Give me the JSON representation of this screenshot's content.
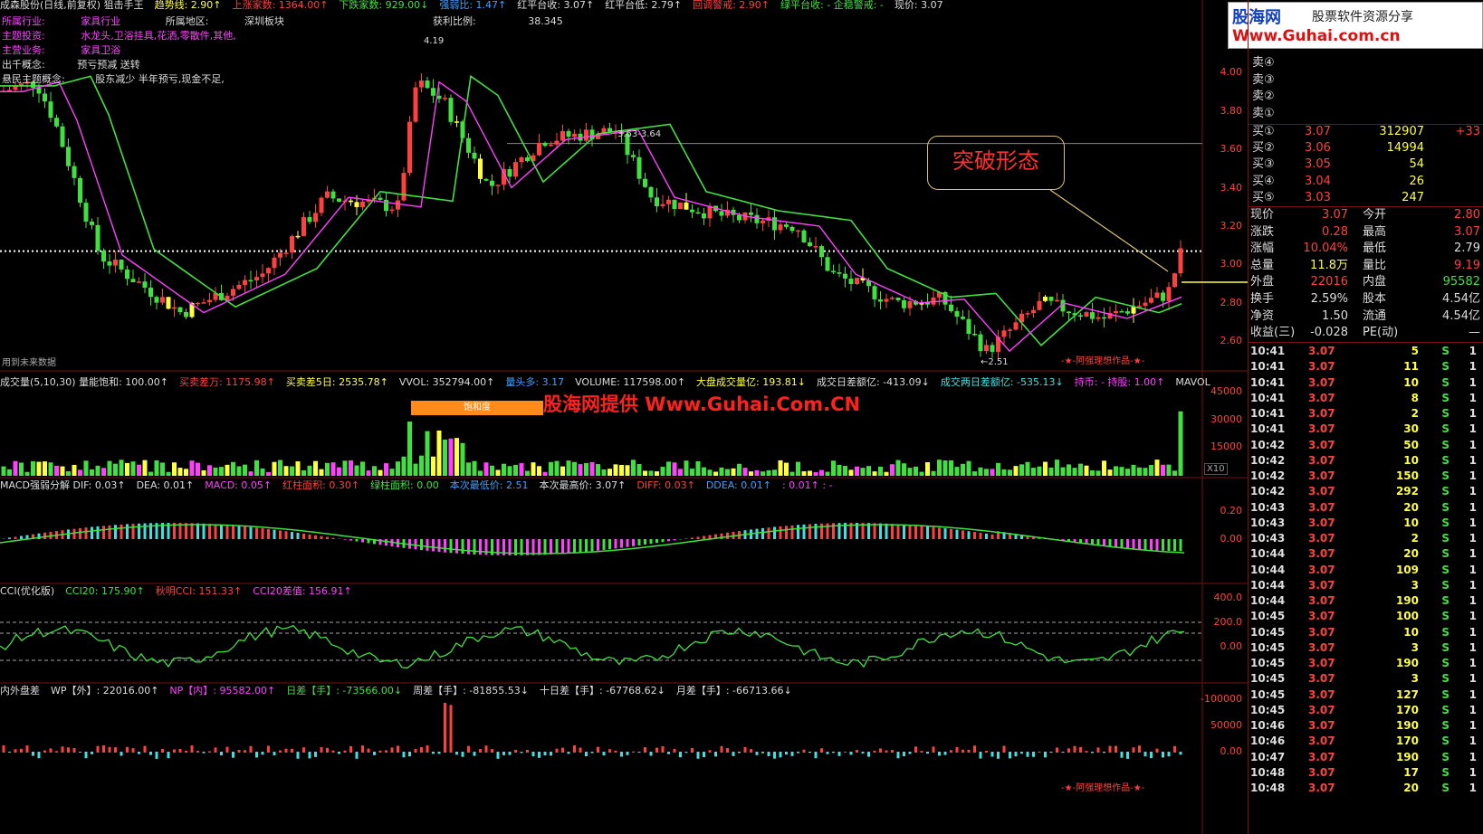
{
  "colors": {
    "up": "#ff4040",
    "down": "#40e040",
    "yellow": "#ffff40",
    "magenta": "#ff40ff",
    "cyan": "#40e0e0",
    "grid": "#7a1010"
  },
  "header": {
    "items": [
      {
        "text": "成森股份(日线,前复权) 狙击手王",
        "color": "#dddddd"
      },
      {
        "text": "趋势线: 2.90↑",
        "color": "#ffff40"
      },
      {
        "text": "上涨家数: 1364.00↑",
        "color": "#ff4040"
      },
      {
        "text": "下跌家数: 929.00↓",
        "color": "#40e040"
      },
      {
        "text": "强弱比: 1.47↑",
        "color": "#40a0ff"
      },
      {
        "text": "红平台收: 3.07↑",
        "color": "#dddddd"
      },
      {
        "text": "红平台低: 2.79↑",
        "color": "#dddddd"
      },
      {
        "text": "回调警戒: 2.90↑",
        "color": "#ff4040"
      },
      {
        "text": "绿平台收: - 企稳警戒: -",
        "color": "#40e040"
      },
      {
        "text": "现价: 3.07",
        "color": "#dddddd"
      }
    ]
  },
  "info_lines": [
    {
      "label": "所属行业:",
      "value": "家具行业",
      "extra_label": "所属地区:",
      "extra_value": "深圳板块",
      "color": "#ff40ff"
    },
    {
      "label": "主题投资:",
      "value": "水龙头,卫浴挂具,花洒,零散件,其他,",
      "color": "#ff40ff"
    },
    {
      "label": "主营业务:",
      "value": "家具卫浴",
      "color": "#ff40ff"
    },
    {
      "label": "出千概念:",
      "value": "预亏预减 送转",
      "color": "#dddddd"
    },
    {
      "label": "悬民主题概念:",
      "value": "股东减少 半年预亏,现金不足,",
      "color": "#dddddd"
    }
  ],
  "profit_ratio": {
    "label": "获利比例:",
    "value": "38.345"
  },
  "price_axis": [
    "4.00",
    "3.80",
    "3.60",
    "3.40",
    "3.20",
    "3.00",
    "2.80",
    "2.60"
  ],
  "annotations": {
    "high": "4.19",
    "low": "←2.51",
    "platform": "3.63-3.64",
    "future_note": "用到未来数据",
    "author": "-★-阿强理想作品-★-"
  },
  "callout_text": "突破形态",
  "watermark": "股海网提供 Www.Guhai.Com.CN",
  "volume_header": [
    {
      "text": "成交量(5,10,30) 量能饱和: 100.00↑",
      "color": "#dddddd"
    },
    {
      "text": "买卖差万: 1175.98↑",
      "color": "#ff4040"
    },
    {
      "text": "买卖差5日: 2535.78↑",
      "color": "#ffff40"
    },
    {
      "text": "VVOL: 352794.00↑",
      "color": "#dddddd"
    },
    {
      "text": "量头多: 3.17",
      "color": "#40a0ff"
    },
    {
      "text": "VOLUME: 117598.00↑",
      "color": "#dddddd"
    },
    {
      "text": "大盘成交量亿: 193.81↓",
      "color": "#ffff40"
    },
    {
      "text": "成交日差额亿: -413.09↓",
      "color": "#dddddd"
    },
    {
      "text": "成交两日差额亿: -535.13↓",
      "color": "#40e0e0"
    },
    {
      "text": "持币: - 持股: 1.00↑",
      "color": "#ff40ff"
    },
    {
      "text": "MAVOL",
      "color": "#dddddd"
    }
  ],
  "saturation_label": "饱和度",
  "volume_axis": [
    "45000",
    "30000",
    "15000"
  ],
  "volume_unit": "X10",
  "macd_header": [
    {
      "text": "MACD强弱分解 DIF: 0.03↑",
      "color": "#dddddd"
    },
    {
      "text": "DEA: 0.01↑",
      "color": "#dddddd"
    },
    {
      "text": "MACD: 0.05↑",
      "color": "#ff40ff"
    },
    {
      "text": "红柱面积: 0.30↑",
      "color": "#ff4040"
    },
    {
      "text": "绿柱面积: 0.00",
      "color": "#40e040"
    },
    {
      "text": "本次最低价: 2.51",
      "color": "#40a0ff"
    },
    {
      "text": "本次最高价: 3.07↑",
      "color": "#dddddd"
    },
    {
      "text": "DIFF: 0.03↑",
      "color": "#ff4040"
    },
    {
      "text": "DDEA: 0.01↑",
      "color": "#40a0ff"
    },
    {
      "text": ": 0.01↑ : -",
      "color": "#ff40ff"
    }
  ],
  "macd_axis": [
    "0.20",
    "0.00"
  ],
  "cci_header": [
    {
      "text": "CCI(优化版)",
      "color": "#dddddd"
    },
    {
      "text": "CCI20: 175.90↑",
      "color": "#40e040"
    },
    {
      "text": "秋明CCI: 151.33↑",
      "color": "#ff4040"
    },
    {
      "text": "CCI20差值: 156.91↑",
      "color": "#ff40ff"
    }
  ],
  "cci_axis": [
    "400.0",
    "200.0",
    "0.00"
  ],
  "np_header": [
    {
      "text": "内外盘差",
      "color": "#dddddd"
    },
    {
      "text": "WP【外】: 22016.00↑",
      "color": "#dddddd"
    },
    {
      "text": "NP【内】: 95582.00↑",
      "color": "#ff40ff"
    },
    {
      "text": "日差【手】: -73566.00↓",
      "color": "#40e040"
    },
    {
      "text": "周差【手】: -81855.53↓",
      "color": "#dddddd"
    },
    {
      "text": "十日差【手】: -67768.62↓",
      "color": "#dddddd"
    },
    {
      "text": "月差【手】: -66713.66↓",
      "color": "#dddddd"
    }
  ],
  "np_axis": [
    "-100000",
    "50000",
    "0.00"
  ],
  "logo": {
    "title": "股海网",
    "subtitle": "股票软件资源分享",
    "url": "Www.Guhai.com.cn"
  },
  "order_book": {
    "sells": [
      {
        "label": "卖④"
      },
      {
        "label": "卖③"
      },
      {
        "label": "卖②"
      },
      {
        "label": "卖①"
      }
    ],
    "buys": [
      {
        "label": "买①",
        "price": "3.07",
        "volume": "312907",
        "change": "+33"
      },
      {
        "label": "买②",
        "price": "3.06",
        "volume": "14994",
        "change": ""
      },
      {
        "label": "买③",
        "price": "3.05",
        "volume": "54",
        "change": ""
      },
      {
        "label": "买④",
        "price": "3.04",
        "volume": "26",
        "change": ""
      },
      {
        "label": "买⑤",
        "price": "3.03",
        "volume": "247",
        "change": ""
      }
    ]
  },
  "stats": [
    {
      "l1": "现价",
      "v1": "3.07",
      "l2": "今开",
      "v2": "2.80",
      "c1": "#ff4040",
      "c2": "#ff4040"
    },
    {
      "l1": "涨跌",
      "v1": "0.28",
      "l2": "最高",
      "v2": "3.07",
      "c1": "#ff4040",
      "c2": "#ff4040"
    },
    {
      "l1": "涨幅",
      "v1": "10.04%",
      "l2": "最低",
      "v2": "2.79",
      "c1": "#ff4040",
      "c2": "#dddddd"
    },
    {
      "l1": "总量",
      "v1": "11.8万",
      "l2": "量比",
      "v2": "9.19",
      "c1": "#ffff40",
      "c2": "#ff4040"
    },
    {
      "l1": "外盘",
      "v1": "22016",
      "l2": "内盘",
      "v2": "95582",
      "c1": "#ff4040",
      "c2": "#40e040"
    },
    {
      "l1": "换手",
      "v1": "2.59%",
      "l2": "股本",
      "v2": "4.54亿",
      "c1": "#dddddd",
      "c2": "#dddddd"
    },
    {
      "l1": "净资",
      "v1": "1.50",
      "l2": "流通",
      "v2": "4.54亿",
      "c1": "#dddddd",
      "c2": "#dddddd"
    },
    {
      "l1": "收益(三)",
      "v1": "-0.028",
      "l2": "PE(动)",
      "v2": "—",
      "c1": "#dddddd",
      "c2": "#dddddd"
    }
  ],
  "ticks": [
    {
      "time": "10:41",
      "price": "3.07",
      "vol": "5",
      "side": "S",
      "n": "1"
    },
    {
      "time": "10:41",
      "price": "3.07",
      "vol": "11",
      "side": "S",
      "n": "1"
    },
    {
      "time": "10:41",
      "price": "3.07",
      "vol": "10",
      "side": "S",
      "n": "1"
    },
    {
      "time": "10:41",
      "price": "3.07",
      "vol": "8",
      "side": "S",
      "n": "1"
    },
    {
      "time": "10:41",
      "price": "3.07",
      "vol": "2",
      "side": "S",
      "n": "1"
    },
    {
      "time": "10:41",
      "price": "3.07",
      "vol": "30",
      "side": "S",
      "n": "1"
    },
    {
      "time": "10:42",
      "price": "3.07",
      "vol": "50",
      "side": "S",
      "n": "1"
    },
    {
      "time": "10:42",
      "price": "3.07",
      "vol": "10",
      "side": "S",
      "n": "1"
    },
    {
      "time": "10:42",
      "price": "3.07",
      "vol": "150",
      "side": "S",
      "n": "1"
    },
    {
      "time": "10:42",
      "price": "3.07",
      "vol": "292",
      "side": "S",
      "n": "1"
    },
    {
      "time": "10:43",
      "price": "3.07",
      "vol": "20",
      "side": "S",
      "n": "1"
    },
    {
      "time": "10:43",
      "price": "3.07",
      "vol": "10",
      "side": "S",
      "n": "1"
    },
    {
      "time": "10:43",
      "price": "3.07",
      "vol": "2",
      "side": "S",
      "n": "1"
    },
    {
      "time": "10:44",
      "price": "3.07",
      "vol": "20",
      "side": "S",
      "n": "1"
    },
    {
      "time": "10:44",
      "price": "3.07",
      "vol": "109",
      "side": "S",
      "n": "1"
    },
    {
      "time": "10:44",
      "price": "3.07",
      "vol": "3",
      "side": "S",
      "n": "1"
    },
    {
      "time": "10:44",
      "price": "3.07",
      "vol": "190",
      "side": "S",
      "n": "1"
    },
    {
      "time": "10:45",
      "price": "3.07",
      "vol": "100",
      "side": "S",
      "n": "1"
    },
    {
      "time": "10:45",
      "price": "3.07",
      "vol": "10",
      "side": "S",
      "n": "1"
    },
    {
      "time": "10:45",
      "price": "3.07",
      "vol": "3",
      "side": "S",
      "n": "1"
    },
    {
      "time": "10:45",
      "price": "3.07",
      "vol": "190",
      "side": "S",
      "n": "1"
    },
    {
      "time": "10:45",
      "price": "3.07",
      "vol": "3",
      "side": "S",
      "n": "1"
    },
    {
      "time": "10:45",
      "price": "3.07",
      "vol": "127",
      "side": "S",
      "n": "1"
    },
    {
      "time": "10:45",
      "price": "3.07",
      "vol": "170",
      "side": "S",
      "n": "1"
    },
    {
      "time": "10:46",
      "price": "3.07",
      "vol": "190",
      "side": "S",
      "n": "1"
    },
    {
      "time": "10:46",
      "price": "3.07",
      "vol": "170",
      "side": "S",
      "n": "1"
    },
    {
      "time": "10:47",
      "price": "3.07",
      "vol": "190",
      "side": "S",
      "n": "1"
    },
    {
      "time": "10:48",
      "price": "3.07",
      "vol": "17",
      "side": "S",
      "n": "1"
    },
    {
      "time": "10:48",
      "price": "3.07",
      "vol": "20",
      "side": "S",
      "n": "1"
    }
  ]
}
